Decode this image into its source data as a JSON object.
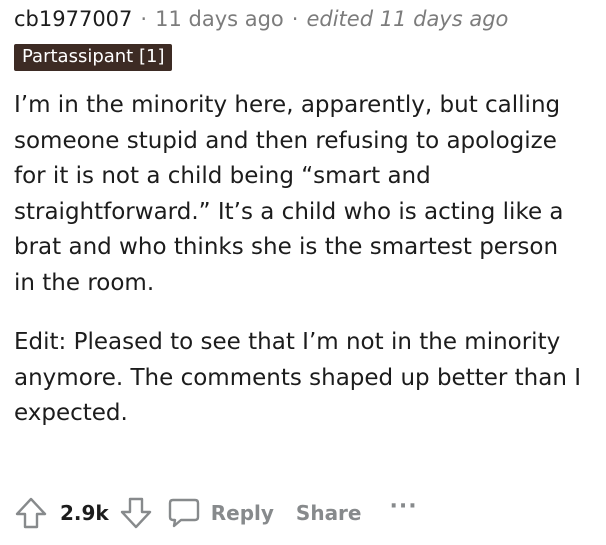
{
  "comment": {
    "author": "cb1977007",
    "time": "11 days ago",
    "edited": "edited 11 days ago",
    "flair": "Partassipant [1]",
    "paragraphs": [
      "I’m in the minority here, apparently, but calling someone stupid and then refusing to apologize for it is not a child being “smart and straightforward.” It’s a child who is acting like a brat and who thinks she is the smartest person in the room.",
      "Edit: Pleased to see that I’m not in the minority anymore. The comments shaped up better than I expected."
    ]
  },
  "actions": {
    "upvote_icon": "upvote-arrow-icon",
    "vote_count": "2.9k",
    "downvote_icon": "downvote-arrow-icon",
    "reply_icon": "speech-bubble-icon",
    "reply_label": "Reply",
    "share_label": "Share",
    "more_icon": "more-dots-icon",
    "more_glyph": "···"
  }
}
